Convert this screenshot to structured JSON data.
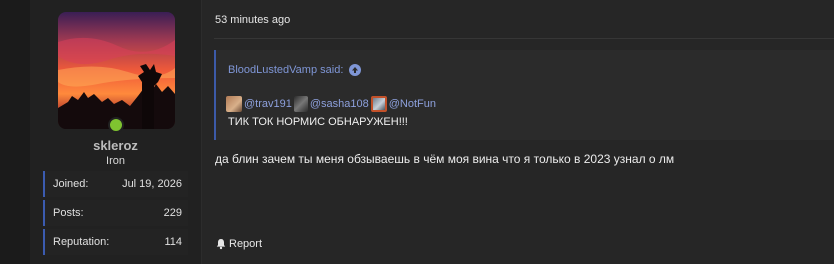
{
  "user": {
    "username": "skleroz",
    "rank": "Iron",
    "online": true,
    "stats": [
      {
        "label": "Joined:",
        "value": "Jul 19, 2026"
      },
      {
        "label": "Posts:",
        "value": "229"
      },
      {
        "label": "Reputation:",
        "value": "114"
      }
    ]
  },
  "post": {
    "timestamp": "53 minutes ago",
    "quote": {
      "author_line": "BloodLustedVamp said:",
      "mentions": [
        "@trav191",
        "@sasha108",
        "@NotFun"
      ],
      "text": "ТИК ТОК НОРМИС ОБНАРУЖЕН!!!"
    },
    "body": "да блин зачем ты меня обзываешь в чём моя вина что я только в 2023 узнал о лм",
    "report_label": "Report"
  },
  "colors": {
    "accent": "#3c5aa8",
    "link": "#7f96d6",
    "online": "#7fc330"
  },
  "icons": {
    "quote_jump": "arrow-up-circle-icon",
    "report": "bell-icon"
  }
}
